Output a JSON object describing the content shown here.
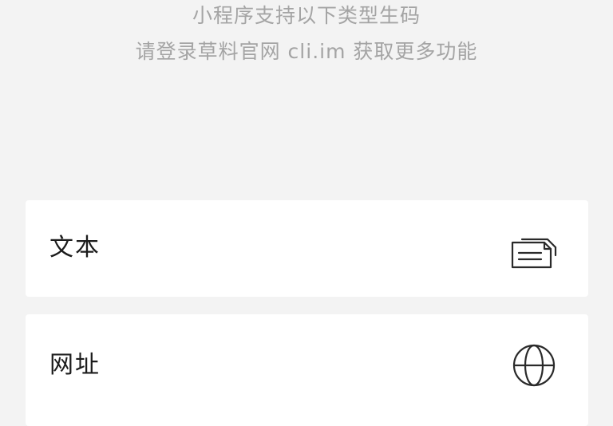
{
  "intro": {
    "line1": "小程序支持以下类型生码",
    "line2": "请登录草料官网 cli.im 获取更多功能"
  },
  "options": [
    {
      "label": "文本",
      "icon": "text-document-icon"
    },
    {
      "label": "网址",
      "icon": "globe-icon"
    }
  ],
  "colors": {
    "background": "#f3f3f3",
    "card": "#ffffff",
    "hint_text": "#a4a4a4",
    "label_text": "#1c1c1c",
    "icon_stroke": "#2a2a2a"
  }
}
